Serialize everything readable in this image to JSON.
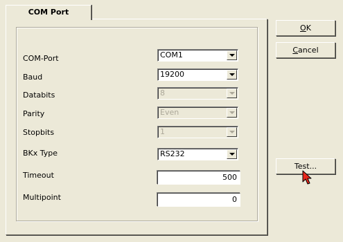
{
  "tab": {
    "label": "COM Port"
  },
  "fields": {
    "com_port": {
      "label": "COM-Port",
      "value": "COM1"
    },
    "baud": {
      "label": "Baud",
      "value": "19200"
    },
    "databits": {
      "label": "Databits",
      "value": "8"
    },
    "parity": {
      "label": "Parity",
      "value": "Even"
    },
    "stopbits": {
      "label": "Stopbits",
      "value": "1"
    },
    "bkx_type": {
      "label": "BKx Type",
      "value": "RS232"
    },
    "timeout": {
      "label": "Timeout",
      "value": "500"
    },
    "multipoint": {
      "label": "Multipoint",
      "value": "0"
    }
  },
  "buttons": {
    "ok_mnemonic": "O",
    "ok_rest": "K",
    "cancel_mnemonic": "C",
    "cancel_rest": "ancel",
    "test": "Test..."
  },
  "icons": {
    "cursor": "mouse-pointer-icon",
    "dropdown": "chevron-down-icon"
  },
  "colors": {
    "dialog_background": "#ece9d8",
    "field_background": "#ffffff",
    "disabled_text": "#aca899",
    "cursor": "#e8271b"
  }
}
